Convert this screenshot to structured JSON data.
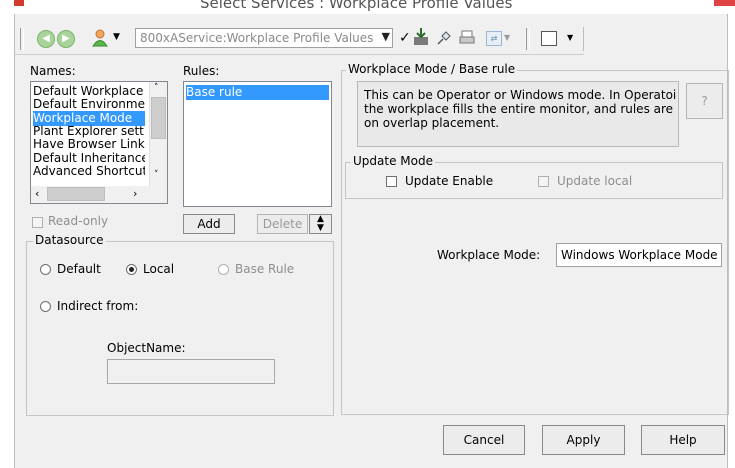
{
  "window": {
    "title": "Select Services : Workplace Profile Values"
  },
  "toolbar": {
    "back_icon": "back-arrow-icon",
    "forward_icon": "forward-arrow-icon",
    "user_icon": "user-icon",
    "path_value": "800xAService:Workplace Profile Values",
    "tool_icons": [
      "download-icon",
      "pin-icon",
      "printer-icon",
      "format-icon",
      "window-icon"
    ]
  },
  "names": {
    "label": "Names:",
    "items": [
      "Default Workplace",
      "Default Environmer",
      "Workplace Mode",
      "Plant Explorer setti",
      "Have Browser Links",
      "Default Inheritance",
      "Advanced Shortcut"
    ],
    "selected_index": 2
  },
  "rules": {
    "label": "Rules:",
    "items": [
      "Base rule"
    ],
    "selected_index": 0
  },
  "readonly_label": "Read-only",
  "add_label": "Add",
  "delete_label": "Delete",
  "datasource": {
    "title": "Datasource",
    "default_label": "Default",
    "local_label": "Local",
    "base_rule_label": "Base Rule",
    "indirect_label": "Indirect from:",
    "selected": "Local",
    "objectname_label": "ObjectName:",
    "objectname_value": ""
  },
  "rule_panel": {
    "title": "Workplace Mode / Base rule",
    "description_lines": [
      "This can be Operator or Windows mode. In Operatoi",
      "the workplace fills the entire monitor, and rules are",
      "on overlap placement."
    ],
    "help_label": "?"
  },
  "update_mode": {
    "title": "Update Mode",
    "update_enable_label": "Update Enable",
    "update_local_label": "Update local"
  },
  "workplace_mode": {
    "label": "Workplace Mode:",
    "value": "Windows Workplace Mode"
  },
  "buttons": {
    "cancel": "Cancel",
    "apply": "Apply",
    "help": "Help"
  }
}
